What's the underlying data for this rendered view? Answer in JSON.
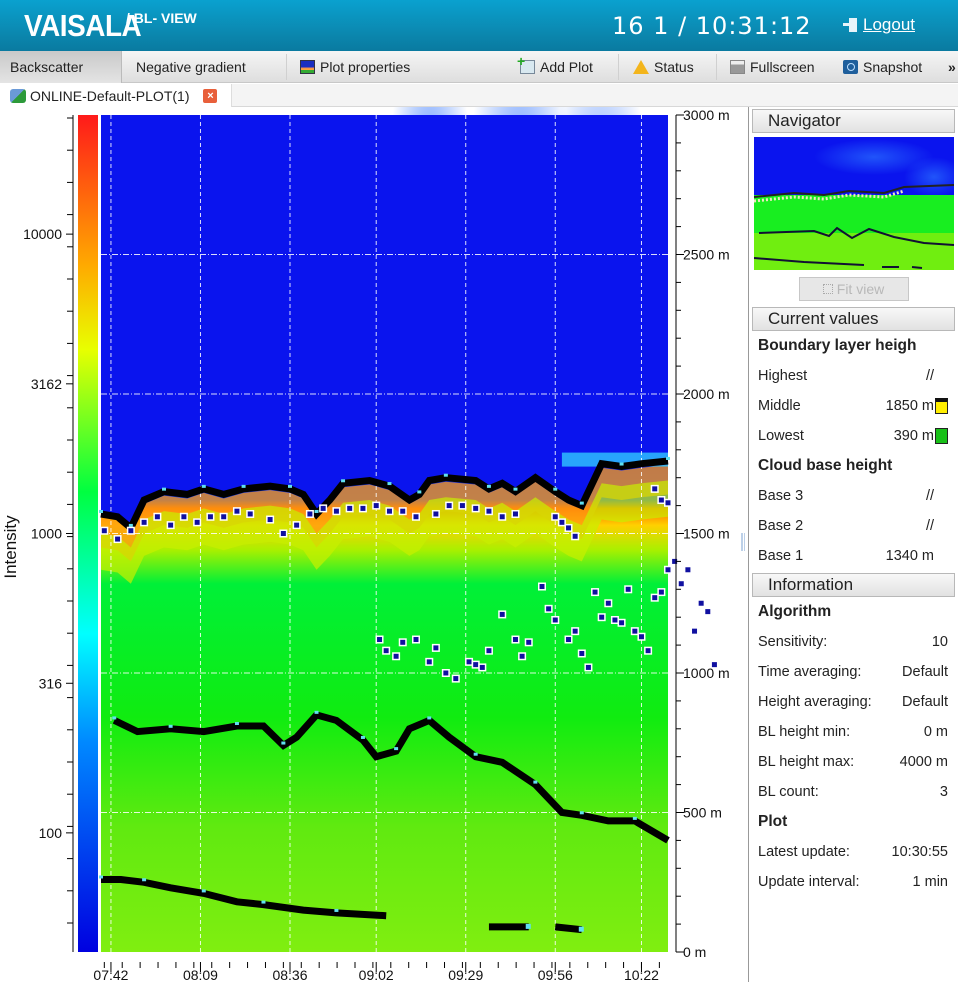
{
  "header": {
    "logo": "VAISALA",
    "product": "/ BL- VIEW",
    "clock": "16 1 / 10:31:12",
    "logout": "Logout"
  },
  "toolbar": {
    "tabs": [
      {
        "label": "Backscatter",
        "active": true
      },
      {
        "label": "Negative gradient",
        "active": false
      }
    ],
    "plot_properties": "Plot properties",
    "add_plot": "Add Plot",
    "status": "Status",
    "fullscreen": "Fullscreen",
    "snapshot": "Snapshot",
    "more": "»"
  },
  "plot_tab": {
    "label": "ONLINE-Default-PLOT(1)",
    "close": "×"
  },
  "chart_data": {
    "type": "heatmap",
    "title": "",
    "colorbar": {
      "label": "Intensity",
      "scale": "log",
      "range": [
        40,
        25000
      ],
      "ticks": [
        {
          "value": 10000,
          "label": "10000"
        },
        {
          "value": 3162,
          "label": "3162"
        },
        {
          "value": 1000,
          "label": "1000"
        },
        {
          "value": 316,
          "label": "316"
        },
        {
          "value": 100,
          "label": "100"
        }
      ],
      "colors": [
        "#0000e0",
        "#0070ff",
        "#00ffff",
        "#00ff40",
        "#ffff00",
        "#ff9000",
        "#ff1010"
      ]
    },
    "x_axis": {
      "label": "",
      "range_min": [
        459,
        630
      ],
      "ticks": [
        {
          "min": 462,
          "label": "07:42"
        },
        {
          "min": 489,
          "label": "08:09"
        },
        {
          "min": 516,
          "label": "08:36"
        },
        {
          "min": 542,
          "label": "09:02"
        },
        {
          "min": 569,
          "label": "09:29"
        },
        {
          "min": 596,
          "label": "09:56"
        },
        {
          "min": 622,
          "label": "10:22"
        }
      ],
      "grid": true
    },
    "y_axis": {
      "label": "",
      "unit": "m",
      "range": [
        0,
        3000
      ],
      "ticks": [
        {
          "value": 3000,
          "label": "3000 m"
        },
        {
          "value": 2500,
          "label": "2500 m"
        },
        {
          "value": 2000,
          "label": "2000 m"
        },
        {
          "value": 1500,
          "label": "1500 m"
        },
        {
          "value": 1000,
          "label": "1000 m"
        },
        {
          "value": 500,
          "label": "500 m"
        },
        {
          "value": 0,
          "label": "0 m"
        }
      ],
      "grid": true
    },
    "series": [
      {
        "name": "BL height (middle)",
        "kind": "line-markers",
        "color": "#000000",
        "points_min_m": [
          [
            459,
            1570
          ],
          [
            464,
            1560
          ],
          [
            468,
            1520
          ],
          [
            472,
            1620
          ],
          [
            478,
            1650
          ],
          [
            485,
            1640
          ],
          [
            490,
            1660
          ],
          [
            496,
            1640
          ],
          [
            502,
            1660
          ],
          [
            510,
            1670
          ],
          [
            516,
            1660
          ],
          [
            520,
            1640
          ],
          [
            524,
            1570
          ],
          [
            528,
            1620
          ],
          [
            532,
            1680
          ],
          [
            540,
            1690
          ],
          [
            546,
            1670
          ],
          [
            552,
            1620
          ],
          [
            555,
            1640
          ],
          [
            558,
            1690
          ],
          [
            563,
            1700
          ],
          [
            572,
            1690
          ],
          [
            576,
            1660
          ],
          [
            580,
            1680
          ],
          [
            584,
            1650
          ],
          [
            590,
            1700
          ],
          [
            596,
            1650
          ],
          [
            600,
            1620
          ],
          [
            604,
            1600
          ],
          [
            610,
            1750
          ],
          [
            616,
            1740
          ],
          [
            622,
            1750
          ],
          [
            630,
            1760
          ]
        ]
      },
      {
        "name": "BL height (lowest)",
        "kind": "line-markers",
        "color": "#000000",
        "points_min_m": [
          [
            463,
            830
          ],
          [
            470,
            790
          ],
          [
            480,
            800
          ],
          [
            490,
            790
          ],
          [
            500,
            810
          ],
          [
            508,
            810
          ],
          [
            514,
            740
          ],
          [
            518,
            770
          ],
          [
            524,
            850
          ],
          [
            530,
            830
          ],
          [
            538,
            760
          ],
          [
            542,
            700
          ],
          [
            548,
            720
          ],
          [
            552,
            800
          ],
          [
            558,
            830
          ],
          [
            564,
            770
          ],
          [
            572,
            700
          ],
          [
            580,
            680
          ],
          [
            590,
            600
          ],
          [
            598,
            500
          ],
          [
            604,
            490
          ],
          [
            612,
            470
          ],
          [
            620,
            470
          ],
          [
            630,
            400
          ]
        ]
      },
      {
        "name": "BL height (low residual)",
        "kind": "line-markers",
        "color": "#000000",
        "points_min_m": [
          [
            459,
            260
          ],
          [
            465,
            260
          ],
          [
            472,
            250
          ],
          [
            480,
            230
          ],
          [
            490,
            210
          ],
          [
            500,
            180
          ],
          [
            508,
            170
          ],
          [
            520,
            150
          ],
          [
            530,
            140
          ],
          [
            545,
            130
          ]
        ]
      },
      {
        "name": "BL height fragments",
        "kind": "segments",
        "color": "#000000",
        "segments_min_m": [
          [
            [
              576,
              90
            ],
            [
              588,
              90
            ]
          ],
          [
            [
              596,
              90
            ],
            [
              604,
              80
            ]
          ]
        ]
      },
      {
        "name": "Cloud base",
        "kind": "scatter",
        "color": "#1010a0",
        "points_min_m": [
          [
            460,
            1510
          ],
          [
            464,
            1480
          ],
          [
            468,
            1510
          ],
          [
            472,
            1540
          ],
          [
            476,
            1560
          ],
          [
            480,
            1530
          ],
          [
            484,
            1560
          ],
          [
            488,
            1540
          ],
          [
            492,
            1560
          ],
          [
            496,
            1560
          ],
          [
            500,
            1580
          ],
          [
            504,
            1570
          ],
          [
            510,
            1550
          ],
          [
            514,
            1500
          ],
          [
            518,
            1530
          ],
          [
            522,
            1570
          ],
          [
            526,
            1590
          ],
          [
            530,
            1580
          ],
          [
            534,
            1590
          ],
          [
            538,
            1590
          ],
          [
            542,
            1600
          ],
          [
            546,
            1580
          ],
          [
            550,
            1580
          ],
          [
            554,
            1560
          ],
          [
            560,
            1570
          ],
          [
            564,
            1600
          ],
          [
            568,
            1600
          ],
          [
            572,
            1590
          ],
          [
            576,
            1580
          ],
          [
            580,
            1560
          ],
          [
            584,
            1570
          ],
          [
            596,
            1560
          ],
          [
            598,
            1540
          ],
          [
            600,
            1520
          ],
          [
            602,
            1490
          ],
          [
            628,
            1620
          ],
          [
            630,
            1610
          ],
          [
            626,
            1660
          ],
          [
            543,
            1120
          ],
          [
            545,
            1080
          ],
          [
            548,
            1060
          ],
          [
            550,
            1110
          ],
          [
            554,
            1120
          ],
          [
            558,
            1040
          ],
          [
            560,
            1090
          ],
          [
            563,
            1000
          ],
          [
            566,
            980
          ],
          [
            570,
            1040
          ],
          [
            572,
            1030
          ],
          [
            574,
            1020
          ],
          [
            576,
            1080
          ],
          [
            580,
            1210
          ],
          [
            584,
            1120
          ],
          [
            586,
            1060
          ],
          [
            588,
            1110
          ],
          [
            592,
            1310
          ],
          [
            594,
            1230
          ],
          [
            596,
            1190
          ],
          [
            600,
            1120
          ],
          [
            602,
            1150
          ],
          [
            604,
            1070
          ],
          [
            606,
            1020
          ],
          [
            608,
            1290
          ],
          [
            610,
            1200
          ],
          [
            612,
            1250
          ],
          [
            614,
            1190
          ],
          [
            616,
            1180
          ],
          [
            618,
            1300
          ],
          [
            620,
            1150
          ],
          [
            622,
            1130
          ],
          [
            624,
            1080
          ],
          [
            626,
            1270
          ],
          [
            628,
            1290
          ],
          [
            630,
            1370
          ],
          [
            632,
            1400
          ],
          [
            634,
            1320
          ],
          [
            636,
            1370
          ],
          [
            638,
            1150
          ],
          [
            640,
            1250
          ],
          [
            642,
            1220
          ],
          [
            644,
            1030
          ]
        ]
      }
    ]
  },
  "navigator": {
    "title": "Navigator",
    "fit_view": "Fit view"
  },
  "current_values": {
    "title": "Current values",
    "boundary_layer": {
      "heading": "Boundary layer heigh",
      "rows": [
        {
          "label": "Highest",
          "value": "//",
          "swatch": null
        },
        {
          "label": "Middle",
          "value": "1850 m",
          "swatch": "#ffee00"
        },
        {
          "label": "Lowest",
          "value": "390 m",
          "swatch": "#18c018"
        }
      ]
    },
    "cloud_base": {
      "heading": "Cloud base height",
      "rows": [
        {
          "label": "Base 3",
          "value": "//"
        },
        {
          "label": "Base 2",
          "value": "//"
        },
        {
          "label": "Base 1",
          "value": "1340 m"
        }
      ]
    }
  },
  "information": {
    "title": "Information",
    "algorithm": {
      "heading": "Algorithm",
      "rows": [
        {
          "label": "Sensitivity:",
          "value": "10"
        },
        {
          "label": "Time averaging:",
          "value": "Default"
        },
        {
          "label": "Height averaging:",
          "value": "Default"
        },
        {
          "label": "BL height min:",
          "value": "0 m"
        },
        {
          "label": "BL height max:",
          "value": "4000 m"
        },
        {
          "label": "BL count:",
          "value": "3"
        }
      ]
    },
    "plot": {
      "heading": "Plot",
      "rows": [
        {
          "label": "Latest update:",
          "value": "10:30:55"
        },
        {
          "label": "Update interval:",
          "value": "1 min"
        }
      ]
    }
  }
}
